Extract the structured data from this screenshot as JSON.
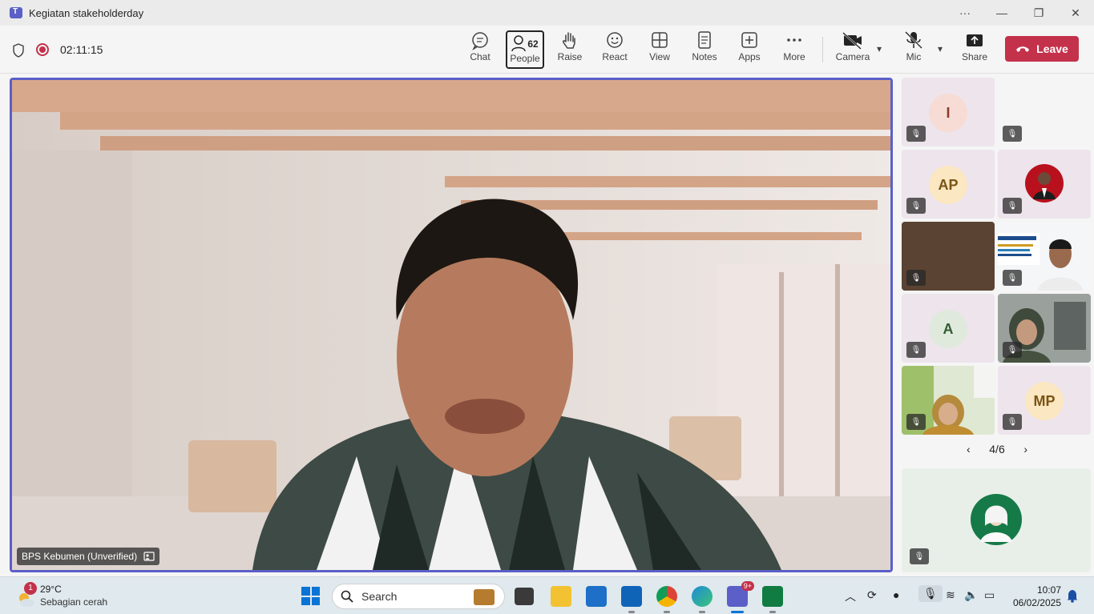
{
  "window": {
    "title": "Kegiatan stakeholderday",
    "more": "···",
    "minimize": "—",
    "maximize": "❐",
    "close": "✕"
  },
  "meeting": {
    "timer": "02:11:15"
  },
  "toolbar": {
    "chat": "Chat",
    "people": "People",
    "people_count": "62",
    "raise": "Raise",
    "react": "React",
    "view": "View",
    "notes": "Notes",
    "apps": "Apps",
    "more": "More",
    "camera": "Camera",
    "mic": "Mic",
    "share": "Share",
    "leave": "Leave"
  },
  "stage": {
    "speaker_name": "BPS Kebumen (Unverified)"
  },
  "gallery": {
    "tiles": [
      {
        "initials": "I"
      },
      {
        "initials": ""
      },
      {
        "initials": "AP"
      },
      {
        "initials": ""
      },
      {
        "initials": ""
      },
      {
        "initials": ""
      },
      {
        "initials": "A"
      },
      {
        "initials": ""
      },
      {
        "initials": ""
      },
      {
        "initials": "MP"
      }
    ],
    "pager": "4/6"
  },
  "taskbar": {
    "weather_badge": "1",
    "weather_temp": "29°C",
    "weather_desc": "Sebagian cerah",
    "search_label": "Search",
    "teams_badge": "9+",
    "time": "10:07",
    "date": "06/02/2025"
  },
  "colors": {
    "accent": "#5b5fc7",
    "leave": "#c4314b"
  }
}
